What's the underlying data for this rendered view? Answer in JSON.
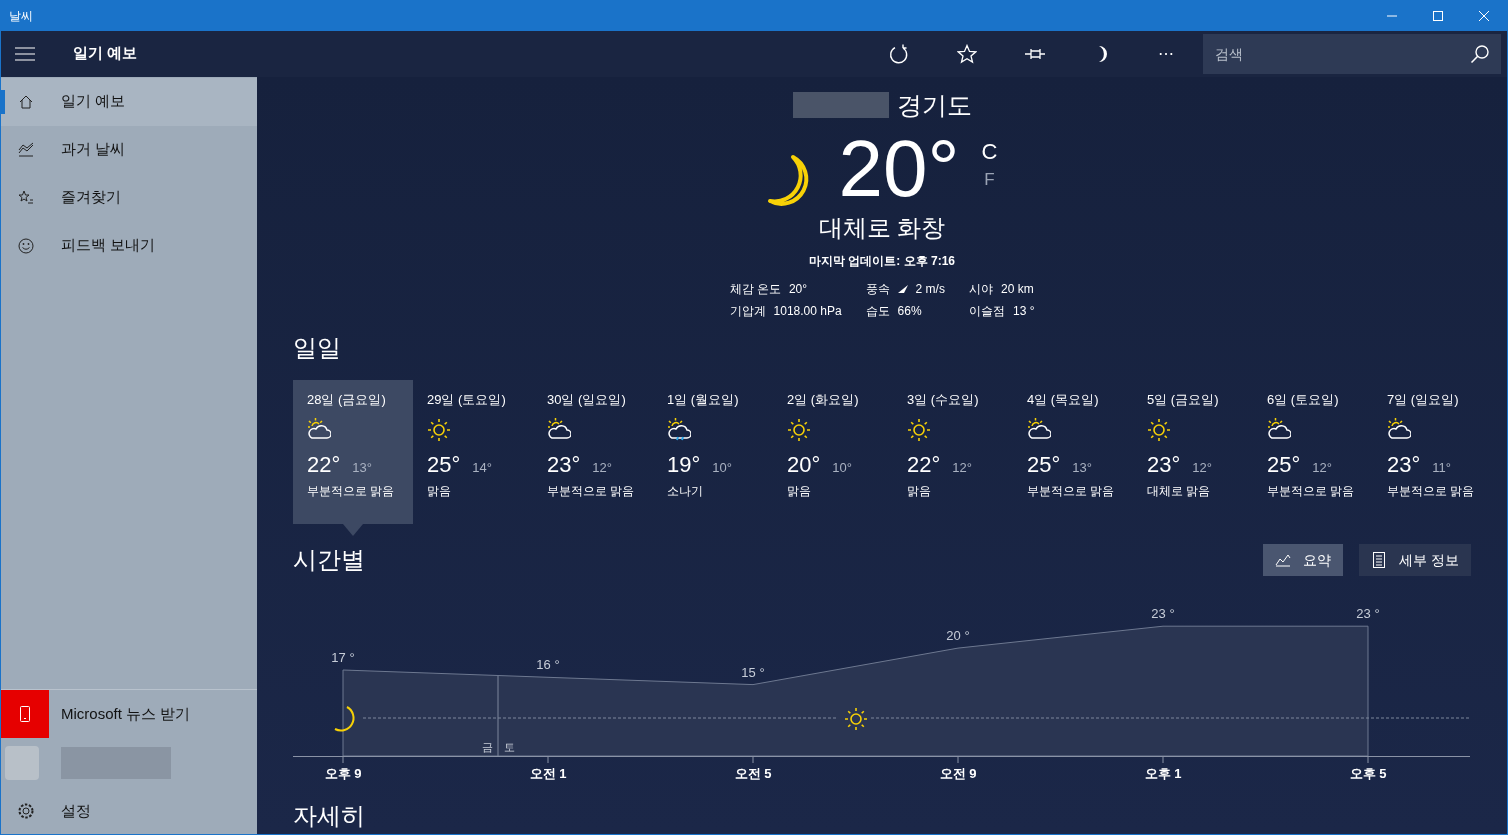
{
  "window": {
    "title": "날씨"
  },
  "header": {
    "title": "일기 예보",
    "more": "⋯",
    "search": {
      "placeholder": "검색"
    }
  },
  "sidebar": {
    "items": [
      {
        "label": "일기 예보",
        "kind": "home",
        "selected": true
      },
      {
        "label": "과거 날씨",
        "kind": "history",
        "selected": false
      },
      {
        "label": "즐겨찾기",
        "kind": "favorites",
        "selected": false
      },
      {
        "label": "피드백 보내기",
        "kind": "feedback",
        "selected": false
      }
    ],
    "news": {
      "label": "Microsoft 뉴스 받기"
    },
    "settings": {
      "label": "설정"
    }
  },
  "current": {
    "region": "경기도",
    "temperature": "20°",
    "units": [
      {
        "label": "C",
        "selected": true
      },
      {
        "label": "F",
        "selected": false
      }
    ],
    "condition": "대체로 화창",
    "updated": "마지막 업데이트: 오후 7:16",
    "details": [
      {
        "label": "체감 온도",
        "value": "20°",
        "arrow": false
      },
      {
        "label": "풍속",
        "value": "2 m/s",
        "arrow": true
      },
      {
        "label": "시야",
        "value": "20 km",
        "arrow": false
      },
      {
        "label": "기압계",
        "value": "1018.00 hPa",
        "arrow": false
      },
      {
        "label": "습도",
        "value": "66%",
        "arrow": false
      },
      {
        "label": "이슬점",
        "value": "13 °",
        "arrow": false
      }
    ]
  },
  "daily": {
    "heading": "일일",
    "days": [
      {
        "date": "28일 (금요일)",
        "kind": "partly-sunny",
        "high": "22°",
        "low": "13°",
        "condition": "부분적으로 맑음",
        "selected": true
      },
      {
        "date": "29일 (토요일)",
        "kind": "sunny",
        "high": "25°",
        "low": "14°",
        "condition": "맑음",
        "selected": false
      },
      {
        "date": "30일 (일요일)",
        "kind": "partly-sunny",
        "high": "23°",
        "low": "12°",
        "condition": "부분적으로 맑음",
        "selected": false
      },
      {
        "date": "1일 (월요일)",
        "kind": "showers",
        "high": "19°",
        "low": "10°",
        "condition": "소나기",
        "selected": false
      },
      {
        "date": "2일 (화요일)",
        "kind": "sunny",
        "high": "20°",
        "low": "10°",
        "condition": "맑음",
        "selected": false
      },
      {
        "date": "3일 (수요일)",
        "kind": "sunny",
        "high": "22°",
        "low": "12°",
        "condition": "맑음",
        "selected": false
      },
      {
        "date": "4일 (목요일)",
        "kind": "partly-sunny",
        "high": "25°",
        "low": "13°",
        "condition": "부분적으로 맑음",
        "selected": false
      },
      {
        "date": "5일 (금요일)",
        "kind": "sunny",
        "high": "23°",
        "low": "12°",
        "condition": "대체로 맑음",
        "selected": false
      },
      {
        "date": "6일 (토요일)",
        "kind": "partly-sunny",
        "high": "25°",
        "low": "12°",
        "condition": "부분적으로 맑음",
        "selected": false
      },
      {
        "date": "7일 (일요일)",
        "kind": "partly-sunny",
        "high": "23°",
        "low": "11°",
        "condition": "부분적으로 맑음",
        "selected": false
      }
    ]
  },
  "hourly": {
    "heading": "시간별",
    "buttons": [
      {
        "label": "요약",
        "kind": "summary",
        "selected": true
      },
      {
        "label": "세부 정보",
        "kind": "details",
        "selected": false
      }
    ],
    "day_change": [
      "금",
      "토"
    ],
    "chart_data": {
      "type": "area",
      "categories": [
        "오후 9",
        "오전 1",
        "오전 5",
        "오전 9",
        "오후 1",
        "오후 5"
      ],
      "series": [
        {
          "color": "#2a3552",
          "values": [
            17,
            16,
            15,
            20,
            23,
            23
          ],
          "value_labels": [
            "17 °",
            "16 °",
            "15 °",
            "20 °",
            "23 °",
            "23 °"
          ]
        }
      ]
    }
  },
  "details_heading": "자세히"
}
